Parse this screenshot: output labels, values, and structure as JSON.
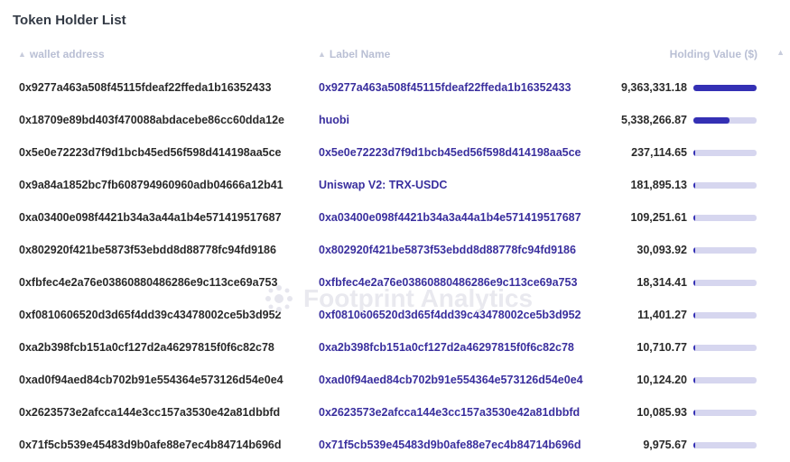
{
  "title": "Token Holder List",
  "columns": {
    "wallet": "wallet address",
    "label": "Label Name",
    "holding": "Holding Value ($)"
  },
  "watermark": "Footprint Analytics",
  "colors": {
    "bar_fill": "#3430b4",
    "bar_track": "#d6d6ef",
    "label_text": "#3a2f9e"
  },
  "rows": [
    {
      "wallet": "0x9277a463a508f45115fdeaf22ffeda1b16352433",
      "label": "0x9277a463a508f45115fdeaf22ffeda1b16352433",
      "value": "9,363,331.18",
      "ratio": 1.0
    },
    {
      "wallet": "0x18709e89bd403f470088abdacebe86cc60dda12e",
      "label": "huobi",
      "value": "5,338,266.87",
      "ratio": 0.5701
    },
    {
      "wallet": "0x5e0e72223d7f9d1bcb45ed56f598d414198aa5ce",
      "label": "0x5e0e72223d7f9d1bcb45ed56f598d414198aa5ce",
      "value": "237,114.65",
      "ratio": 0.0253
    },
    {
      "wallet": "0x9a84a1852bc7fb608794960960adb04666a12b41",
      "label": "Uniswap V2: TRX-USDC",
      "value": "181,895.13",
      "ratio": 0.0194
    },
    {
      "wallet": "0xa03400e098f4421b34a3a44a1b4e571419517687",
      "label": "0xa03400e098f4421b34a3a44a1b4e571419517687",
      "value": "109,251.61",
      "ratio": 0.0117
    },
    {
      "wallet": "0x802920f421be5873f53ebdd8d88778fc94fd9186",
      "label": "0x802920f421be5873f53ebdd8d88778fc94fd9186",
      "value": "30,093.92",
      "ratio": 0.0032
    },
    {
      "wallet": "0xfbfec4e2a76e03860880486286e9c113ce69a753",
      "label": "0xfbfec4e2a76e03860880486286e9c113ce69a753",
      "value": "18,314.41",
      "ratio": 0.002
    },
    {
      "wallet": "0xf0810606520d3d65f4dd39c43478002ce5b3d952",
      "label": "0xf0810606520d3d65f4dd39c43478002ce5b3d952",
      "value": "11,401.27",
      "ratio": 0.0012
    },
    {
      "wallet": "0xa2b398fcb151a0cf127d2a46297815f0f6c82c78",
      "label": "0xa2b398fcb151a0cf127d2a46297815f0f6c82c78",
      "value": "10,710.77",
      "ratio": 0.0011
    },
    {
      "wallet": "0xad0f94aed84cb702b91e554364e573126d54e0e4",
      "label": "0xad0f94aed84cb702b91e554364e573126d54e0e4",
      "value": "10,124.20",
      "ratio": 0.0011
    },
    {
      "wallet": "0x2623573e2afcca144e3cc157a3530e42a81dbbfd",
      "label": "0x2623573e2afcca144e3cc157a3530e42a81dbbfd",
      "value": "10,085.93",
      "ratio": 0.0011
    },
    {
      "wallet": "0x71f5cb539e45483d9b0afe88e7ec4b84714b696d",
      "label": "0x71f5cb539e45483d9b0afe88e7ec4b84714b696d",
      "value": "9,975.67",
      "ratio": 0.0011
    }
  ]
}
